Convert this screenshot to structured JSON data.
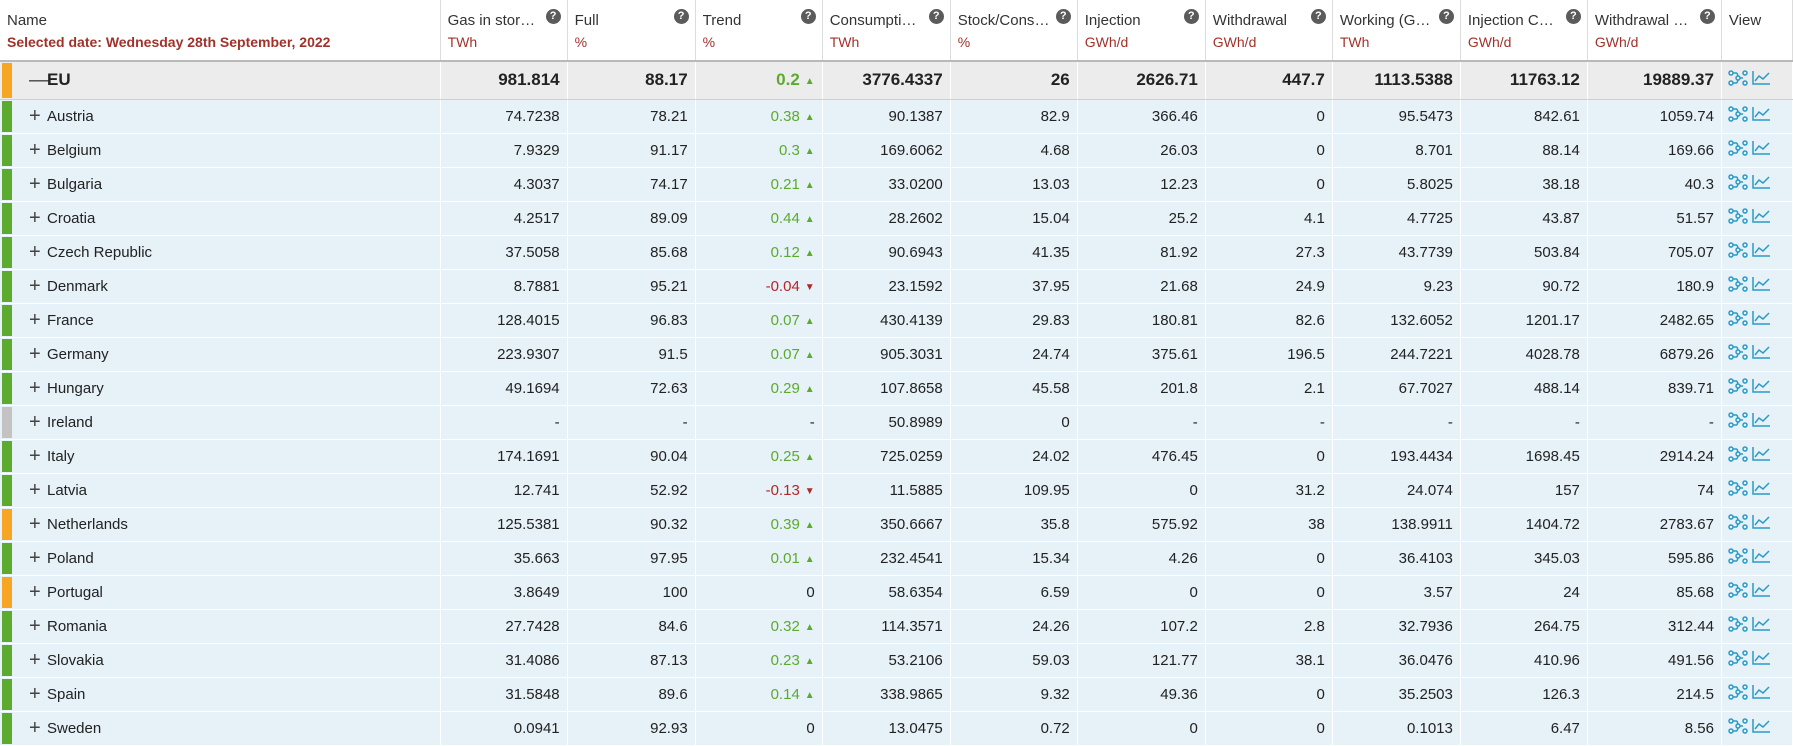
{
  "colors": {
    "unit_red": "#a1322b",
    "trend_up": "#5cab2f",
    "trend_down": "#b42727",
    "stripe_green": "#5cab2f",
    "stripe_orange": "#f6a623",
    "stripe_gray": "#c3c3c3",
    "row_blue": "#e6f1f8",
    "icon_teal": "#2b9bc6"
  },
  "header": {
    "name": "Name",
    "selected_date": "Selected date: Wednesday 28th September, 2022",
    "help_glyph": "?",
    "view": "View",
    "columns": [
      {
        "title": "Gas in storage",
        "unit": "TWh"
      },
      {
        "title": "Full",
        "unit": "%"
      },
      {
        "title": "Trend",
        "unit": "%"
      },
      {
        "title": "Consumption...",
        "unit": "TWh"
      },
      {
        "title": "Stock/Cons *...",
        "unit": "%"
      },
      {
        "title": "Injection",
        "unit": "GWh/d"
      },
      {
        "title": "Withdrawal",
        "unit": "GWh/d"
      },
      {
        "title": "Working (Ga...",
        "unit": "TWh"
      },
      {
        "title": "Injection Cap...",
        "unit": "GWh/d"
      },
      {
        "title": "Withdrawal Ca...",
        "unit": "GWh/d"
      }
    ]
  },
  "eu_row": {
    "expand": "—",
    "name": "EU",
    "status": "orange",
    "values": [
      "981.814",
      "88.17",
      "0.2",
      "3776.4337",
      "26",
      "2626.71",
      "447.7",
      "1113.5388",
      "11763.12",
      "19889.37"
    ],
    "trend": "up"
  },
  "rows": [
    {
      "expand": "+",
      "name": "Austria",
      "status": "green",
      "trend": "up",
      "values": [
        "74.7238",
        "78.21",
        "0.38",
        "90.1387",
        "82.9",
        "366.46",
        "0",
        "95.5473",
        "842.61",
        "1059.74"
      ]
    },
    {
      "expand": "+",
      "name": "Belgium",
      "status": "green",
      "trend": "up",
      "values": [
        "7.9329",
        "91.17",
        "0.3",
        "169.6062",
        "4.68",
        "26.03",
        "0",
        "8.701",
        "88.14",
        "169.66"
      ]
    },
    {
      "expand": "+",
      "name": "Bulgaria",
      "status": "green",
      "trend": "up",
      "values": [
        "4.3037",
        "74.17",
        "0.21",
        "33.0200",
        "13.03",
        "12.23",
        "0",
        "5.8025",
        "38.18",
        "40.3"
      ]
    },
    {
      "expand": "+",
      "name": "Croatia",
      "status": "green",
      "trend": "up",
      "values": [
        "4.2517",
        "89.09",
        "0.44",
        "28.2602",
        "15.04",
        "25.2",
        "4.1",
        "4.7725",
        "43.87",
        "51.57"
      ]
    },
    {
      "expand": "+",
      "name": "Czech Republic",
      "status": "green",
      "trend": "up",
      "values": [
        "37.5058",
        "85.68",
        "0.12",
        "90.6943",
        "41.35",
        "81.92",
        "27.3",
        "43.7739",
        "503.84",
        "705.07"
      ]
    },
    {
      "expand": "+",
      "name": "Denmark",
      "status": "green",
      "trend": "down",
      "values": [
        "8.7881",
        "95.21",
        "-0.04",
        "23.1592",
        "37.95",
        "21.68",
        "24.9",
        "9.23",
        "90.72",
        "180.9"
      ]
    },
    {
      "expand": "+",
      "name": "France",
      "status": "green",
      "trend": "up",
      "values": [
        "128.4015",
        "96.83",
        "0.07",
        "430.4139",
        "29.83",
        "180.81",
        "82.6",
        "132.6052",
        "1201.17",
        "2482.65"
      ]
    },
    {
      "expand": "+",
      "name": "Germany",
      "status": "green",
      "trend": "up",
      "values": [
        "223.9307",
        "91.5",
        "0.07",
        "905.3031",
        "24.74",
        "375.61",
        "196.5",
        "244.7221",
        "4028.78",
        "6879.26"
      ]
    },
    {
      "expand": "+",
      "name": "Hungary",
      "status": "green",
      "trend": "up",
      "values": [
        "49.1694",
        "72.63",
        "0.29",
        "107.8658",
        "45.58",
        "201.8",
        "2.1",
        "67.7027",
        "488.14",
        "839.71"
      ]
    },
    {
      "expand": "+",
      "name": "Ireland",
      "status": "gray",
      "trend": "none",
      "values": [
        "-",
        "-",
        "-",
        "50.8989",
        "0",
        "-",
        "-",
        "-",
        "-",
        "-"
      ]
    },
    {
      "expand": "+",
      "name": "Italy",
      "status": "green",
      "trend": "up",
      "values": [
        "174.1691",
        "90.04",
        "0.25",
        "725.0259",
        "24.02",
        "476.45",
        "0",
        "193.4434",
        "1698.45",
        "2914.24"
      ]
    },
    {
      "expand": "+",
      "name": "Latvia",
      "status": "green",
      "trend": "down",
      "values": [
        "12.741",
        "52.92",
        "-0.13",
        "11.5885",
        "109.95",
        "0",
        "31.2",
        "24.074",
        "157",
        "74"
      ]
    },
    {
      "expand": "+",
      "name": "Netherlands",
      "status": "orange",
      "trend": "up",
      "values": [
        "125.5381",
        "90.32",
        "0.39",
        "350.6667",
        "35.8",
        "575.92",
        "38",
        "138.9911",
        "1404.72",
        "2783.67"
      ]
    },
    {
      "expand": "+",
      "name": "Poland",
      "status": "green",
      "trend": "up",
      "values": [
        "35.663",
        "97.95",
        "0.01",
        "232.4541",
        "15.34",
        "4.26",
        "0",
        "36.4103",
        "345.03",
        "595.86"
      ]
    },
    {
      "expand": "+",
      "name": "Portugal",
      "status": "orange",
      "trend": "none",
      "values": [
        "3.8649",
        "100",
        "0",
        "58.6354",
        "6.59",
        "0",
        "0",
        "3.57",
        "24",
        "85.68"
      ]
    },
    {
      "expand": "+",
      "name": "Romania",
      "status": "green",
      "trend": "up",
      "values": [
        "27.7428",
        "84.6",
        "0.32",
        "114.3571",
        "24.26",
        "107.2",
        "2.8",
        "32.7936",
        "264.75",
        "312.44"
      ]
    },
    {
      "expand": "+",
      "name": "Slovakia",
      "status": "green",
      "trend": "up",
      "values": [
        "31.4086",
        "87.13",
        "0.23",
        "53.2106",
        "59.03",
        "121.77",
        "38.1",
        "36.0476",
        "410.96",
        "491.56"
      ]
    },
    {
      "expand": "+",
      "name": "Spain",
      "status": "green",
      "trend": "up",
      "values": [
        "31.5848",
        "89.6",
        "0.14",
        "338.9865",
        "9.32",
        "49.36",
        "0",
        "35.2503",
        "126.3",
        "214.5"
      ]
    },
    {
      "expand": "+",
      "name": "Sweden",
      "status": "green",
      "trend": "none",
      "values": [
        "0.0941",
        "92.93",
        "0",
        "13.0475",
        "0.72",
        "0",
        "0",
        "0.1013",
        "6.47",
        "8.56"
      ]
    }
  ],
  "icons": {
    "network": "network-flow-icon",
    "chart": "line-chart-icon",
    "arrow_up": "▲",
    "arrow_down": "▼"
  }
}
